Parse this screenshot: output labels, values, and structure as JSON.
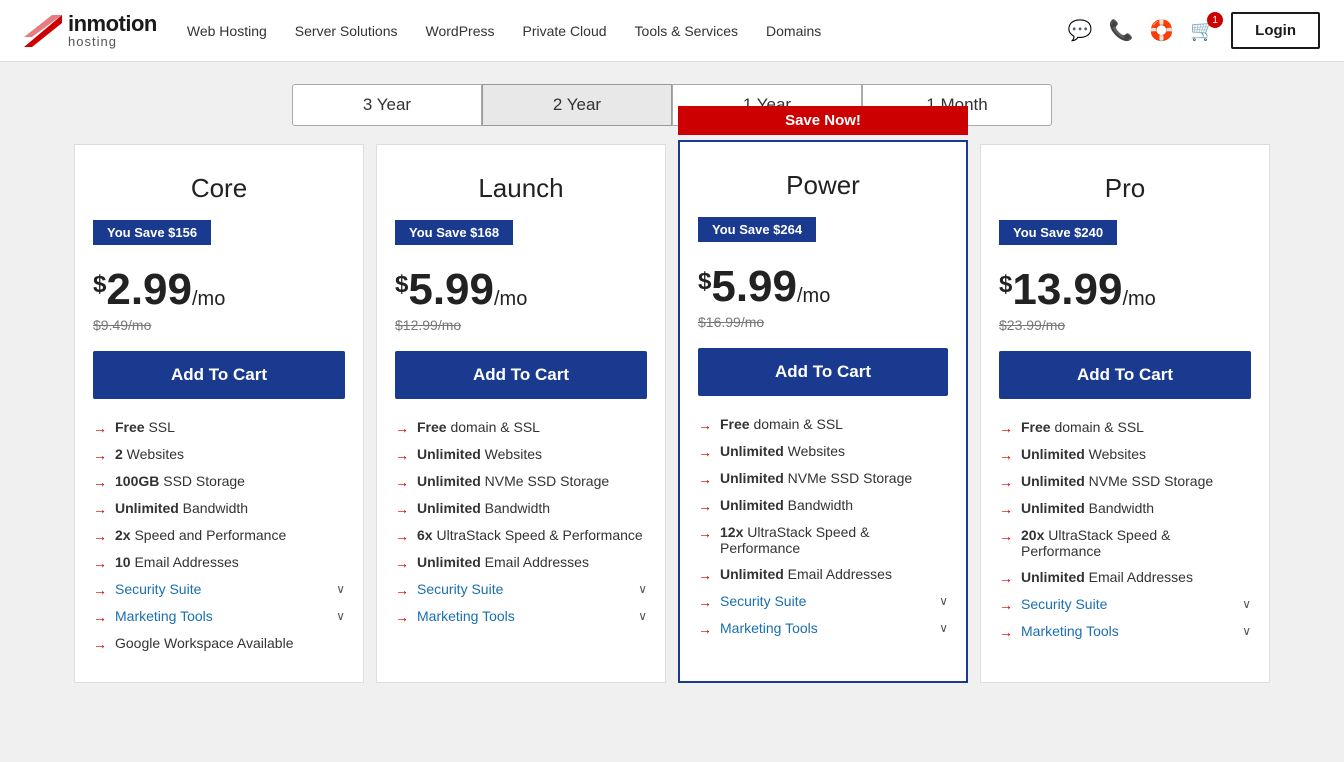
{
  "logo": {
    "brand": "inmotion",
    "sub": "hosting"
  },
  "nav": {
    "links": [
      "Web Hosting",
      "Server Solutions",
      "WordPress",
      "Private Cloud",
      "Tools & Services",
      "Domains"
    ],
    "login_label": "Login",
    "cart_count": "1"
  },
  "billing": {
    "options": [
      "3 Year",
      "2 Year",
      "1 Year",
      "1 Month"
    ],
    "active_index": 1
  },
  "plans": [
    {
      "name": "Core",
      "savings": "You Save $156",
      "price": "2.99",
      "period": "/mo",
      "original": "$9.49/mo",
      "cta": "Add To Cart",
      "highlighted": false,
      "save_now": false,
      "features": [
        {
          "bold": "Free",
          "rest": " SSL",
          "expandable": false
        },
        {
          "bold": "2",
          "rest": " Websites",
          "expandable": false
        },
        {
          "bold": "100GB",
          "rest": " SSD Storage",
          "expandable": false
        },
        {
          "bold": "Unlimited",
          "rest": " Bandwidth",
          "expandable": false
        },
        {
          "bold": "2x",
          "rest": " Speed and Performance",
          "expandable": false
        },
        {
          "bold": "10",
          "rest": " Email Addresses",
          "expandable": false
        },
        {
          "bold": "",
          "rest": "Security Suite",
          "expandable": true
        },
        {
          "bold": "",
          "rest": "Marketing Tools",
          "expandable": true
        },
        {
          "bold": "",
          "rest": "Google Workspace Available",
          "expandable": false
        }
      ]
    },
    {
      "name": "Launch",
      "savings": "You Save $168",
      "price": "5.99",
      "period": "/mo",
      "original": "$12.99/mo",
      "cta": "Add To Cart",
      "highlighted": false,
      "save_now": false,
      "features": [
        {
          "bold": "Free",
          "rest": " domain & SSL",
          "expandable": false
        },
        {
          "bold": "Unlimited",
          "rest": " Websites",
          "expandable": false
        },
        {
          "bold": "Unlimited",
          "rest": " NVMe SSD Storage",
          "expandable": false
        },
        {
          "bold": "Unlimited",
          "rest": " Bandwidth",
          "expandable": false
        },
        {
          "bold": "6x",
          "rest": " UltraStack Speed & Performance",
          "expandable": false
        },
        {
          "bold": "Unlimited",
          "rest": " Email Addresses",
          "expandable": false
        },
        {
          "bold": "",
          "rest": "Security Suite",
          "expandable": true
        },
        {
          "bold": "",
          "rest": "Marketing Tools",
          "expandable": true
        }
      ]
    },
    {
      "name": "Power",
      "savings": "You Save $264",
      "price": "5.99",
      "period": "/mo",
      "original": "$16.99/mo",
      "cta": "Add To Cart",
      "highlighted": true,
      "save_now": true,
      "save_now_label": "Save Now!",
      "features": [
        {
          "bold": "Free",
          "rest": " domain & SSL",
          "expandable": false
        },
        {
          "bold": "Unlimited",
          "rest": " Websites",
          "expandable": false
        },
        {
          "bold": "Unlimited",
          "rest": " NVMe SSD Storage",
          "expandable": false
        },
        {
          "bold": "Unlimited",
          "rest": " Bandwidth",
          "expandable": false
        },
        {
          "bold": "12x",
          "rest": " UltraStack Speed & Performance",
          "expandable": false
        },
        {
          "bold": "Unlimited",
          "rest": " Email Addresses",
          "expandable": false
        },
        {
          "bold": "",
          "rest": "Security Suite",
          "expandable": true
        },
        {
          "bold": "",
          "rest": "Marketing Tools",
          "expandable": true
        }
      ]
    },
    {
      "name": "Pro",
      "savings": "You Save $240",
      "price": "13.99",
      "period": "/mo",
      "original": "$23.99/mo",
      "cta": "Add To Cart",
      "highlighted": false,
      "save_now": false,
      "features": [
        {
          "bold": "Free",
          "rest": " domain & SSL",
          "expandable": false
        },
        {
          "bold": "Unlimited",
          "rest": " Websites",
          "expandable": false
        },
        {
          "bold": "Unlimited",
          "rest": " NVMe SSD Storage",
          "expandable": false
        },
        {
          "bold": "Unlimited",
          "rest": " Bandwidth",
          "expandable": false
        },
        {
          "bold": "20x",
          "rest": " UltraStack Speed & Performance",
          "expandable": false
        },
        {
          "bold": "Unlimited",
          "rest": " Email Addresses",
          "expandable": false
        },
        {
          "bold": "",
          "rest": "Security Suite",
          "expandable": true
        },
        {
          "bold": "",
          "rest": "Marketing Tools",
          "expandable": true
        }
      ]
    }
  ]
}
